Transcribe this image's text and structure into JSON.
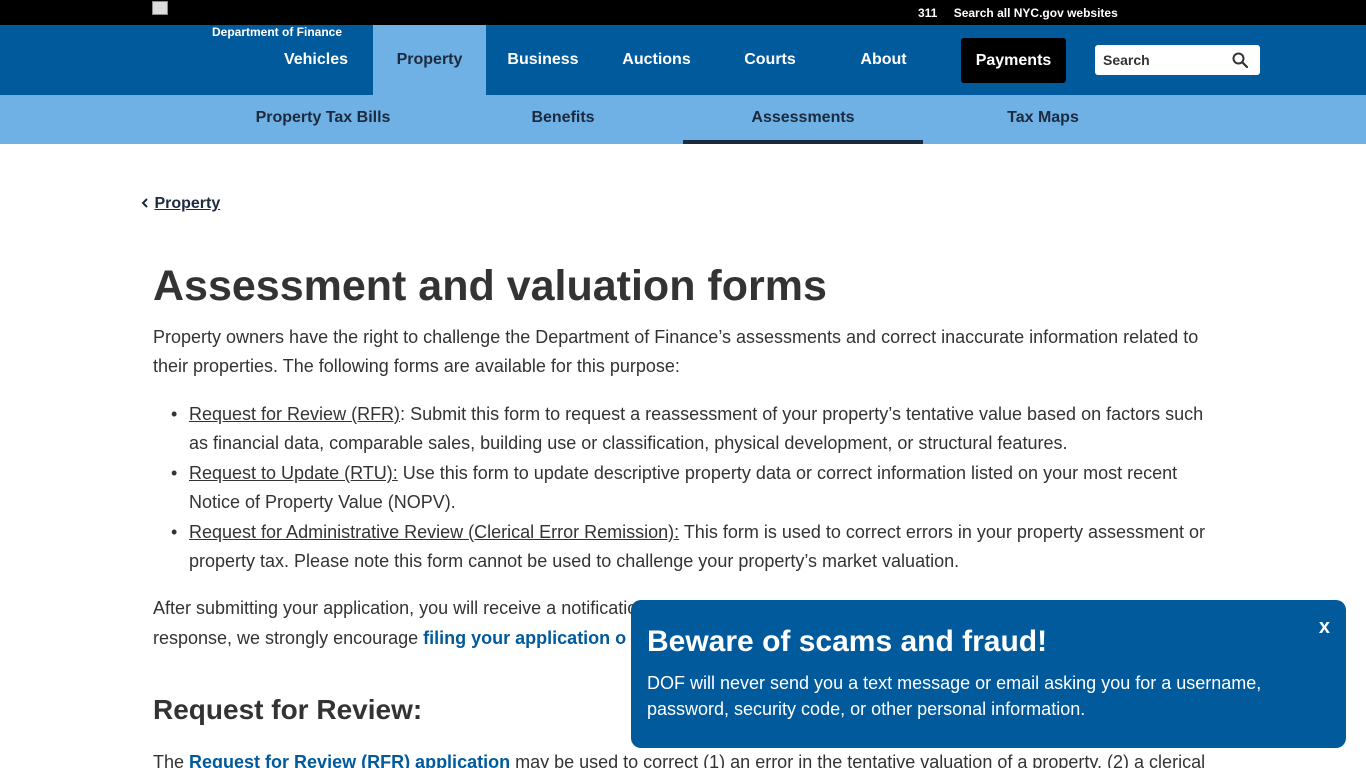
{
  "topbar": {
    "link_311": "311",
    "link_search_all": "Search all NYC.gov websites"
  },
  "header": {
    "department": "Department of Finance",
    "nav": [
      {
        "label": "Vehicles"
      },
      {
        "label": "Property",
        "active": true
      },
      {
        "label": "Business"
      },
      {
        "label": "Auctions"
      },
      {
        "label": "Courts"
      },
      {
        "label": "About"
      }
    ],
    "payments_label": "Payments",
    "search_placeholder": "Search"
  },
  "subnav": [
    {
      "label": "Property Tax Bills"
    },
    {
      "label": "Benefits"
    },
    {
      "label": "Assessments",
      "active": true
    },
    {
      "label": "Tax Maps"
    }
  ],
  "breadcrumb": {
    "label": "Property"
  },
  "main": {
    "title": "Assessment and valuation forms",
    "intro": "Property owners have the right to challenge the Department of Finance’s assessments and correct inaccurate information related to their properties. The following forms are available for this purpose:",
    "forms": [
      {
        "link": "Request for Review (RFR)",
        "text": ": Submit this form to request a reassessment of your property’s tentative value based on factors such as financial data, comparable sales, building use or classification, physical development, or structural features."
      },
      {
        "link": "Request to Update (RTU):",
        "text": " Use this form to update descriptive property data or correct information listed on your most recent Notice of Property Value (NOPV)."
      },
      {
        "link": "Request for Administrative Review (Clerical Error Remission):",
        "text": " This form is used to correct errors in your property assessment or property tax. Please note this form cannot be used to challenge your property’s market valuation."
      }
    ],
    "after_line1": "After submitting your application, you will receive a notificatio",
    "after_line2_prefix": "response, we strongly encourage ",
    "after_link": "filing your application o",
    "section_heading": "Request for Review:",
    "last_prefix": "The ",
    "last_link": "Request for Review (RFR) application",
    "last_suffix": " may be used to correct (1) an error in the tentative valuation of a property, (2) a clerical"
  },
  "alert": {
    "title": "Beware of scams and fraud!",
    "body": "DOF will never send you a text message or email asking you for a username, password, security code, or other personal information.",
    "close_label": "x"
  },
  "colors": {
    "nav_blue": "#005a9c",
    "light_blue": "#6fb1e4",
    "dark_navy": "#1b2a3f",
    "text": "#333333"
  }
}
